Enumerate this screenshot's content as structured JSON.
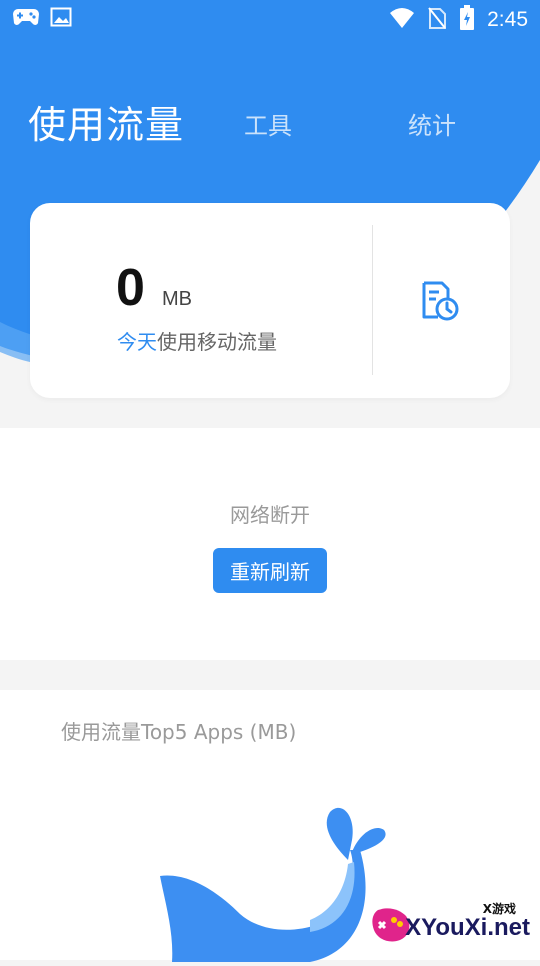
{
  "status_bar": {
    "time": "2:45",
    "left_icons": [
      "gamepad-icon",
      "image-icon"
    ],
    "right_icons": [
      "wifi-icon",
      "no-sim-icon",
      "battery-charging-icon"
    ]
  },
  "tabs": [
    {
      "label": "使用流量",
      "active": true
    },
    {
      "label": "工具",
      "active": false
    },
    {
      "label": "统计",
      "active": false
    }
  ],
  "usage_card": {
    "value": "0",
    "unit": "MB",
    "label_highlight": "今天",
    "label_rest": "使用移动流量",
    "history_icon": "data-history-icon"
  },
  "offline_panel": {
    "message": "网络断开",
    "refresh_label": "重新刷新"
  },
  "top5_panel": {
    "title": "使用流量Top5 Apps (MB)",
    "illustration": "whale-illustration"
  },
  "watermark": {
    "small": "X游戏",
    "big": "XYouXi.net"
  },
  "colors": {
    "primary": "#2f8cf0",
    "background": "#f4f4f4",
    "card": "#ffffff"
  }
}
